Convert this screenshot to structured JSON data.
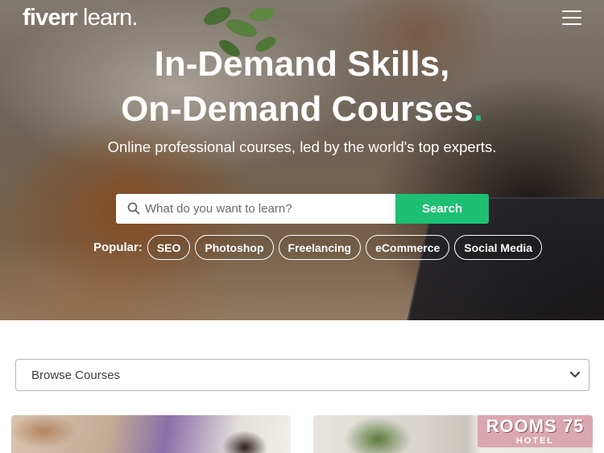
{
  "brand": {
    "name_bold": "fiverr",
    "name_light": " learn."
  },
  "header": {
    "menu_icon": "hamburger-menu-icon"
  },
  "hero": {
    "title_line1": "In-Demand Skills,",
    "title_line2": "On-Demand Courses",
    "title_dot": ".",
    "subtitle": "Online professional courses, led by the world's top experts.",
    "accent_color": "#1dbf73"
  },
  "search": {
    "placeholder": "What do you want to learn?",
    "value": "",
    "button_label": "Search",
    "icon": "search-icon"
  },
  "popular": {
    "label": "Popular:",
    "tags": [
      "SEO",
      "Photoshop",
      "Freelancing",
      "eCommerce",
      "Social Media"
    ]
  },
  "browse": {
    "label": "Browse Courses",
    "icon": "chevron-down-icon"
  },
  "cards": [
    {
      "image": "course-thumbnail"
    },
    {
      "image": "course-thumbnail",
      "sign_text": "ROOMS 75",
      "sign_sub": "HOTEL"
    }
  ]
}
